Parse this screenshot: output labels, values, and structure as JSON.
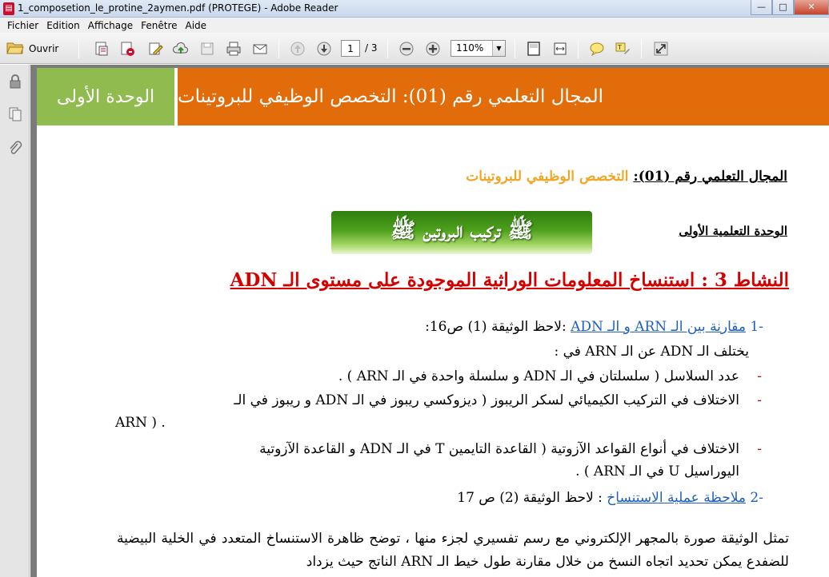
{
  "window": {
    "title": "1_composetion_le_protine_2aymen.pdf (PROTEGE) - Adobe Reader",
    "minimize": "—",
    "maximize": "□",
    "close": "✕"
  },
  "menu": [
    "Fichier",
    "Edition",
    "Affichage",
    "Fenêtre",
    "Aide"
  ],
  "toolbar": {
    "open_label": "Ouvrir",
    "page_value": "1",
    "page_total": "/ 3",
    "zoom_value": "110%"
  },
  "document": {
    "banner_unit": "الوحدة الأولى",
    "banner_title": "المجال التعلمي رقم (01): التخصص الوظيفي للبروتينات",
    "domain_label": "المجال التعلمي رقم (01):",
    "domain_value": "التخصص الوظيفي للبروتينات",
    "unit_label": "الوحدة التعلمية الأولى",
    "protein_box": "ﷺ تركيب البروتين ﷺ",
    "activity_title": "النشاط 3 :   استنساخ المعلومات الوراثية الموجودة على مستوى الـ ADN",
    "item1_num": "-1",
    "item1_link": "مقارنة بين الـ ARN و الـ ADN",
    "item1_rest": " :لاحظ الوثيقة (1) ص16:",
    "diff_intro": "يختلف الـ ADN عن الـ ARN في :",
    "bullet1": "عدد السلاسل ( سلسلتان في الـ ADN و سلسلة واحدة في الـ ARN ) .",
    "bullet2a": "الاختلاف في التركيب الكيميائي لسكر الريبوز ( ديزوكسي ريبوز في الـ ADN و ريبوز في الـ",
    "bullet2b": "ARN ) .",
    "bullet3a": "الاختلاف في أنواع القواعد الآزوتية   ( القاعدة التايمين T في الـ ADN و القاعدة الآزوتية",
    "bullet3b": "اليوراسيل U في الـ ARN ) .",
    "item2_num": "-2",
    "item2_link": "ملاحظة عملية الاستنساخ",
    "item2_rest": " : لاحظ الوثيقة (2) ص 17",
    "paragraph": "تمثل الوثيقة صورة بالمجهر الإلكتروني مع رسم تفسيري لجزء منها ، توضح ظاهرة الاستنساخ المتعدد في الخلية البيضية للضفدع يمكن تحديد اتجاه النسخ من خلال مقارنة طول خيط الـ ARN الناتج حيث يزداد"
  },
  "colors": {
    "banner_orange": "#e36c0a",
    "banner_green": "#8fbb4f",
    "activity_red": "#d40000",
    "link_blue": "#1f5fbf",
    "domain_gold": "#f0a626"
  },
  "icons": [
    "pdf-icon",
    "open-folder-icon",
    "create-pdf-icon",
    "export-pdf-icon",
    "edit-icon",
    "upload-icon",
    "save-icon",
    "print-icon",
    "email-icon",
    "prev-page-icon",
    "next-page-icon",
    "zoom-out-icon",
    "zoom-in-icon",
    "fit-page-icon",
    "fit-width-icon",
    "comment-icon",
    "highlight-icon",
    "fullscreen-icon",
    "lock-icon",
    "pages-icon",
    "attachment-icon"
  ]
}
